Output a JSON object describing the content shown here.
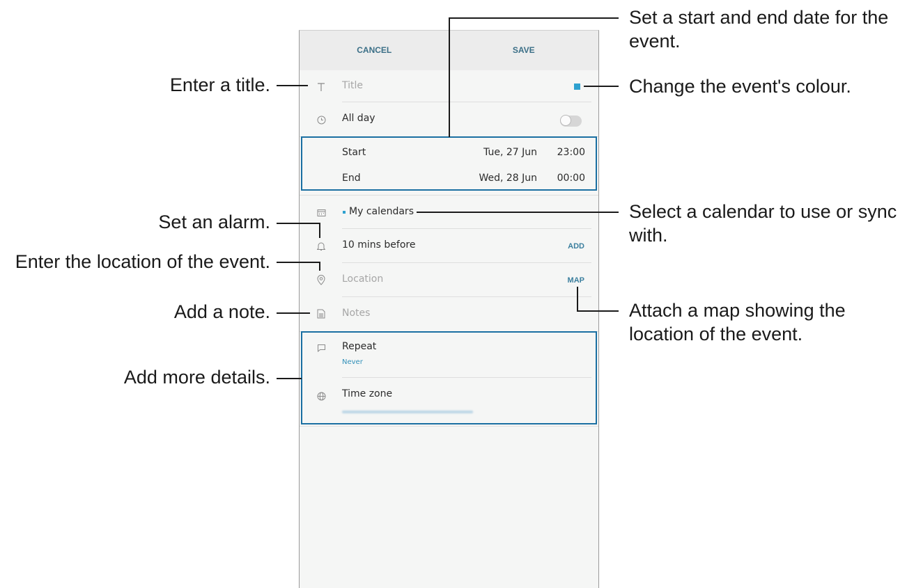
{
  "toolbar": {
    "cancel_label": "CANCEL",
    "save_label": "SAVE"
  },
  "form": {
    "title_placeholder": "Title",
    "all_day_label": "All day",
    "all_day_on": false,
    "start_label": "Start",
    "start_date": "Tue, 27 Jun",
    "start_time": "23:00",
    "end_label": "End",
    "end_date": "Wed, 28 Jun",
    "end_time": "00:00",
    "calendar_label": "My calendars",
    "alarm_label": "10 mins before",
    "alarm_add": "ADD",
    "location_placeholder": "Location",
    "map_label": "MAP",
    "notes_placeholder": "Notes",
    "repeat_label": "Repeat",
    "repeat_value": "Never",
    "timezone_label": "Time zone",
    "event_color": "#2ea1cf"
  },
  "callouts": {
    "title": "Enter a title.",
    "alarm": "Set an alarm.",
    "location": "Enter the location of the event.",
    "note": "Add a note.",
    "details": "Add more details.",
    "dates_line1": "Set a start and end date for the",
    "dates_line2": "event.",
    "colour": "Change the event's colour.",
    "calendar_line1": "Select a calendar to use or sync",
    "calendar_line2": "with.",
    "map_line1": "Attach a map showing the",
    "map_line2": "location of the event."
  },
  "icons": [
    "text-icon",
    "clock-icon",
    "calendar-icon",
    "bell-icon",
    "location-pin-icon",
    "note-icon",
    "repeat-icon",
    "globe-icon"
  ]
}
